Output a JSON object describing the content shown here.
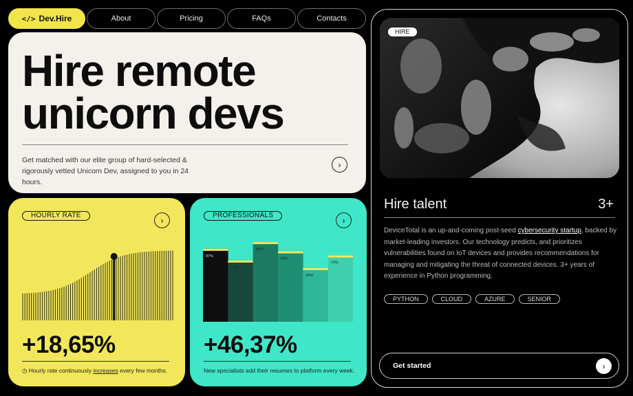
{
  "nav": {
    "logo_icon": "</>",
    "logo_label": "Dev.Hire",
    "items": [
      "About",
      "Pricing",
      "FAQs",
      "Contacts"
    ]
  },
  "hero": {
    "title_line1": "Hire remote",
    "title_line2": "unicorn devs",
    "text": "Get matched with our elite group of hard-selected & rigorously vetted Unicorn Dev, assigned to you in 24 hours.",
    "arrow": "›"
  },
  "hourly": {
    "tag": "HOURLY RATE",
    "arrow": "›",
    "value": "+18,65%",
    "foot_before": "Hourly rate continuously ",
    "foot_link": "increases",
    "foot_after": " every few months.",
    "foot_icon": "clock-icon",
    "color": "#f2e75a"
  },
  "professionals": {
    "tag": "PROFESSIONALS",
    "arrow": "›",
    "value": "+46,37%",
    "foot": "New specialists add their resumes to platform every week.",
    "color": "#3fe7c8"
  },
  "chart_data": [
    {
      "type": "bar",
      "title": "",
      "xlabel": "",
      "ylabel": "",
      "categories": [
        "1",
        "2",
        "3",
        "4",
        "5",
        "6"
      ],
      "values": [
        87,
        73,
        95,
        84,
        64,
        79
      ],
      "labels": [
        "87%",
        "73%",
        "95%",
        "84%",
        "64%",
        "79%"
      ],
      "ylim": [
        0,
        100
      ],
      "grid": false
    }
  ],
  "hire_panel": {
    "tag": "HIRE",
    "title": "Hire talent",
    "count": "3+",
    "text_before": "DeviceTotal is an up-and-coming post-seed ",
    "text_link": "cybersecurity startup",
    "text_after": ", backed by market-leading investors. Our technology predicts, and prioritizes vulnerabilities found on IoT devices and provides recommendations for managing and mitigating the threat of connected devices. 3+ years of experience in Python programming.",
    "skills": [
      "PYTHON",
      "CLOUD",
      "AZURE",
      "SENIOR"
    ],
    "cta_label": "Get started",
    "cta_arrow": "›"
  }
}
